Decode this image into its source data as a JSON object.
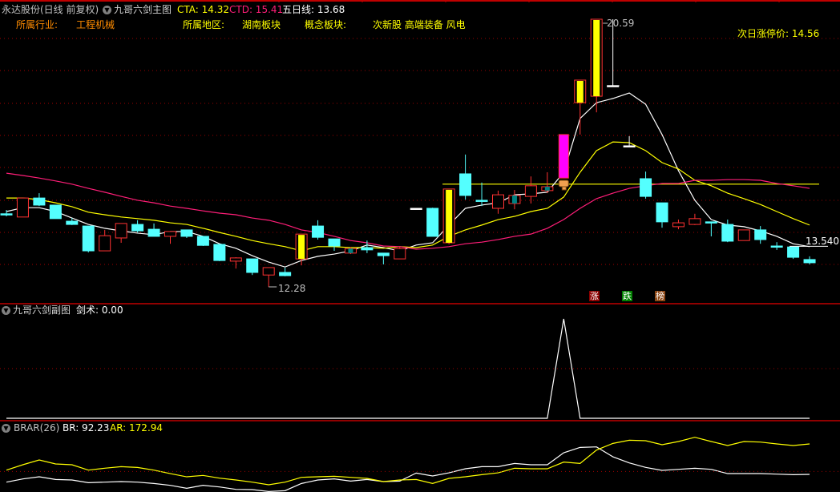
{
  "header": {
    "stock_title": "永达股份(日线 前复权)",
    "indicator_name": "九哥六剑主图",
    "cta_label": "CTA: 14.32",
    "ctd_label": "CTD: 15.41",
    "ma5_label": "五日线: 13.68"
  },
  "info": {
    "industry_label": "所属行业:",
    "industry_value": "工程机械",
    "region_label": "所属地区:",
    "region_value": "湖南板块",
    "concept_label": "概念板块:",
    "concept_value": "次新股 高端装备 风电",
    "limit_up_label": "次日涨停价: 14.56"
  },
  "annotations": {
    "high_label": "20.59",
    "low_label": "12.28",
    "last_label": "13.540"
  },
  "tags": [
    {
      "text": "涨",
      "color": "#8b0000"
    },
    {
      "text": "跌",
      "color": "#008000"
    },
    {
      "text": "榜",
      "color": "#8b4513"
    }
  ],
  "sub1": {
    "title": "九哥六剑副图",
    "value_label": "剑术: 0.00"
  },
  "sub2": {
    "title": "BRAR(26)",
    "br_label": "BR: 92.23",
    "ar_label": "AR: 172.94"
  },
  "colors": {
    "up": "#ff3232",
    "down": "#54ffff",
    "ma5": "#ffffff",
    "cta": "#ffff00",
    "ctd": "#ff1e78",
    "grid": "#a00000",
    "special_yellow": "#ffff00",
    "special_magenta": "#ff00ff",
    "teal": "#008080"
  },
  "chart_data": [
    {
      "type": "candlestick",
      "title": "九哥六剑主图",
      "ylim": [
        12.0,
        20.8
      ],
      "candles": [
        [
          14.55,
          14.67,
          14.47,
          14.55
        ],
        [
          14.45,
          15.04,
          14.45,
          15.04
        ],
        [
          15.04,
          15.19,
          14.79,
          14.82
        ],
        [
          14.82,
          14.82,
          14.4,
          14.4
        ],
        [
          14.32,
          14.42,
          14.2,
          14.22
        ],
        [
          14.17,
          14.17,
          13.35,
          13.4
        ],
        [
          13.4,
          14.05,
          13.4,
          13.87
        ],
        [
          13.8,
          14.25,
          13.65,
          14.25
        ],
        [
          14.22,
          14.35,
          13.97,
          14.02
        ],
        [
          14.07,
          14.25,
          13.85,
          13.85
        ],
        [
          13.85,
          14.0,
          13.62,
          14.0
        ],
        [
          14.05,
          14.05,
          13.8,
          13.85
        ],
        [
          13.85,
          13.85,
          13.55,
          13.57
        ],
        [
          13.6,
          13.6,
          13.08,
          13.1
        ],
        [
          13.08,
          13.2,
          12.85,
          13.18
        ],
        [
          13.15,
          13.15,
          12.65,
          12.73
        ],
        [
          12.65,
          12.88,
          12.28,
          12.88
        ],
        [
          12.73,
          12.88,
          12.61,
          12.63
        ],
        [
          13.15,
          13.92,
          12.95,
          13.92
        ],
        [
          14.17,
          14.35,
          13.75,
          13.82
        ],
        [
          13.77,
          13.77,
          13.4,
          13.55
        ],
        [
          13.33,
          13.52,
          13.3,
          13.47
        ],
        [
          13.5,
          13.72,
          13.33,
          13.43
        ],
        [
          13.33,
          13.33,
          12.98,
          13.25
        ],
        [
          13.15,
          13.52,
          13.15,
          13.47
        ],
        [
          14.72,
          14.72,
          14.72,
          14.72
        ],
        [
          14.72,
          14.74,
          13.85,
          13.85
        ],
        [
          13.65,
          15.32,
          13.6,
          15.32
        ],
        [
          15.79,
          16.39,
          14.99,
          15.12
        ],
        [
          14.97,
          15.52,
          14.79,
          14.97
        ],
        [
          14.72,
          15.27,
          14.55,
          15.14
        ],
        [
          14.87,
          15.29,
          14.69,
          15.12
        ],
        [
          15.09,
          15.71,
          14.87,
          15.42
        ],
        [
          15.27,
          15.84,
          15.19,
          15.39
        ],
        [
          15.66,
          17.01,
          15.66,
          17.01
        ],
        [
          18.0,
          18.7,
          17.01,
          18.7
        ],
        [
          18.2,
          20.59,
          17.7,
          20.59
        ],
        [
          18.53,
          20.59,
          18.53,
          18.53
        ],
        [
          16.66,
          16.96,
          16.66,
          16.66
        ],
        [
          15.64,
          15.86,
          15.02,
          15.09
        ],
        [
          14.89,
          14.89,
          14.12,
          14.3
        ],
        [
          14.15,
          14.37,
          14.07,
          14.27
        ],
        [
          14.22,
          14.55,
          14.2,
          14.4
        ],
        [
          14.3,
          14.3,
          13.85,
          14.3
        ],
        [
          14.22,
          14.37,
          13.67,
          13.7
        ],
        [
          13.72,
          14.05,
          13.72,
          14.05
        ],
        [
          14.05,
          14.17,
          13.62,
          13.75
        ],
        [
          13.55,
          13.67,
          13.43,
          13.55
        ],
        [
          13.52,
          13.52,
          13.15,
          13.2
        ],
        [
          13.13,
          13.23,
          12.98,
          13.03
        ]
      ],
      "candle_styles": {
        "18": "yellow",
        "25": "flat",
        "27": "yellow",
        "21": "teal",
        "31": "teal",
        "33": "teal",
        "34": "magenta",
        "35": "yellow",
        "36": "yellow",
        "37": "flat",
        "38": "flat",
        "0": "cross",
        "22": "cross",
        "29": "cross",
        "43": "cross",
        "47": "cross"
      },
      "series": [
        {
          "name": "五日线",
          "color_key": "ma5",
          "values": [
            14.62,
            14.74,
            14.74,
            14.62,
            14.42,
            14.22,
            14.1,
            14.02,
            13.95,
            13.9,
            14.0,
            14.0,
            13.85,
            13.62,
            13.48,
            13.25,
            13.05,
            12.9,
            13.1,
            13.23,
            13.3,
            13.4,
            13.58,
            13.5,
            13.4,
            13.58,
            13.65,
            14.2,
            14.72,
            14.82,
            14.89,
            15.14,
            15.17,
            15.22,
            15.84,
            17.51,
            18.0,
            18.13,
            18.3,
            17.95,
            17.01,
            15.89,
            14.97,
            14.37,
            14.2,
            14.15,
            14.02,
            13.85,
            13.62,
            13.53
          ]
        },
        {
          "name": "CTA",
          "color_key": "cta",
          "values": [
            15.04,
            15.04,
            14.99,
            14.89,
            14.77,
            14.6,
            14.52,
            14.45,
            14.4,
            14.35,
            14.27,
            14.22,
            14.1,
            13.97,
            13.85,
            13.72,
            13.62,
            13.53,
            13.4,
            13.53,
            13.53,
            13.5,
            13.5,
            13.48,
            13.53,
            13.5,
            13.58,
            13.85,
            14.05,
            14.2,
            14.37,
            14.47,
            14.62,
            14.72,
            15.07,
            15.84,
            16.51,
            16.78,
            16.76,
            16.51,
            16.14,
            15.94,
            15.59,
            15.42,
            15.19,
            15.02,
            14.84,
            14.62,
            14.4,
            14.2
          ]
        },
        {
          "name": "CTD",
          "color_key": "ctd",
          "values": [
            15.81,
            15.74,
            15.66,
            15.57,
            15.47,
            15.34,
            15.22,
            15.09,
            14.97,
            14.89,
            14.79,
            14.72,
            14.64,
            14.57,
            14.52,
            14.42,
            14.35,
            14.22,
            14.05,
            13.97,
            13.85,
            13.72,
            13.65,
            13.55,
            13.53,
            13.45,
            13.48,
            13.53,
            13.62,
            13.67,
            13.75,
            13.85,
            13.92,
            14.1,
            14.37,
            14.72,
            15.02,
            15.19,
            15.34,
            15.42,
            15.49,
            15.49,
            15.59,
            15.59,
            15.61,
            15.61,
            15.59,
            15.49,
            15.42,
            15.34
          ]
        }
      ],
      "horizontal_line": {
        "value": 15.47,
        "from_index": 27
      },
      "high": {
        "value": 20.59,
        "index": 36
      },
      "low": {
        "value": 12.28,
        "index": 16
      },
      "last": 13.54
    },
    {
      "type": "line",
      "title": "九哥六剑副图",
      "ylim": [
        0,
        1
      ],
      "series": [
        {
          "name": "剑术",
          "values": [
            0,
            0,
            0,
            0,
            0,
            0,
            0,
            0,
            0,
            0,
            0,
            0,
            0,
            0,
            0,
            0,
            0,
            0,
            0,
            0,
            0,
            0,
            0,
            0,
            0,
            0,
            0,
            0,
            0,
            0,
            0,
            0,
            0,
            0,
            1,
            0,
            0,
            0,
            0,
            0,
            0,
            0,
            0,
            0,
            0,
            0,
            0,
            0,
            0,
            0
          ]
        }
      ]
    },
    {
      "type": "line",
      "title": "BRAR(26)",
      "series": [
        {
          "name": "BR",
          "color_key": "ma5",
          "values": [
            71.7,
            80.2,
            85.8,
            78.7,
            77.3,
            70.2,
            71.7,
            73.1,
            71.7,
            68.1,
            63.2,
            55.4,
            63.2,
            58.9,
            52.5,
            51.8,
            46.9,
            49.0,
            68.1,
            77.3,
            80.2,
            74.5,
            78.7,
            73.1,
            74.5,
            95.7,
            88.0,
            96.4,
            107.1,
            112.7,
            112.7,
            121.2,
            117.7,
            117.7,
            149.5,
            163.7,
            165.1,
            138.9,
            122.6,
            110.6,
            102.8,
            105.6,
            108.5,
            105.6,
            94.3,
            94.3,
            94.3,
            92.9,
            91.5,
            92.23
          ]
        },
        {
          "name": "AR",
          "color_key": "cta",
          "values": [
            103.5,
            117.7,
            130.4,
            119.8,
            117.7,
            103.5,
            108.5,
            112.7,
            110.6,
            103.5,
            94.3,
            85.8,
            89.4,
            82.3,
            77.3,
            71.7,
            64.6,
            71.7,
            84.4,
            85.8,
            87.2,
            84.4,
            81.6,
            73.1,
            77.3,
            78.7,
            68.1,
            81.6,
            85.8,
            91.5,
            96.4,
            108.5,
            107.1,
            107.1,
            124.8,
            121.2,
            156.6,
            174.3,
            182.8,
            181.4,
            170.8,
            179.3,
            190.6,
            179.3,
            168.7,
            179.3,
            177.9,
            172.9,
            168.7,
            172.94
          ]
        }
      ],
      "reference_line": 100
    }
  ]
}
